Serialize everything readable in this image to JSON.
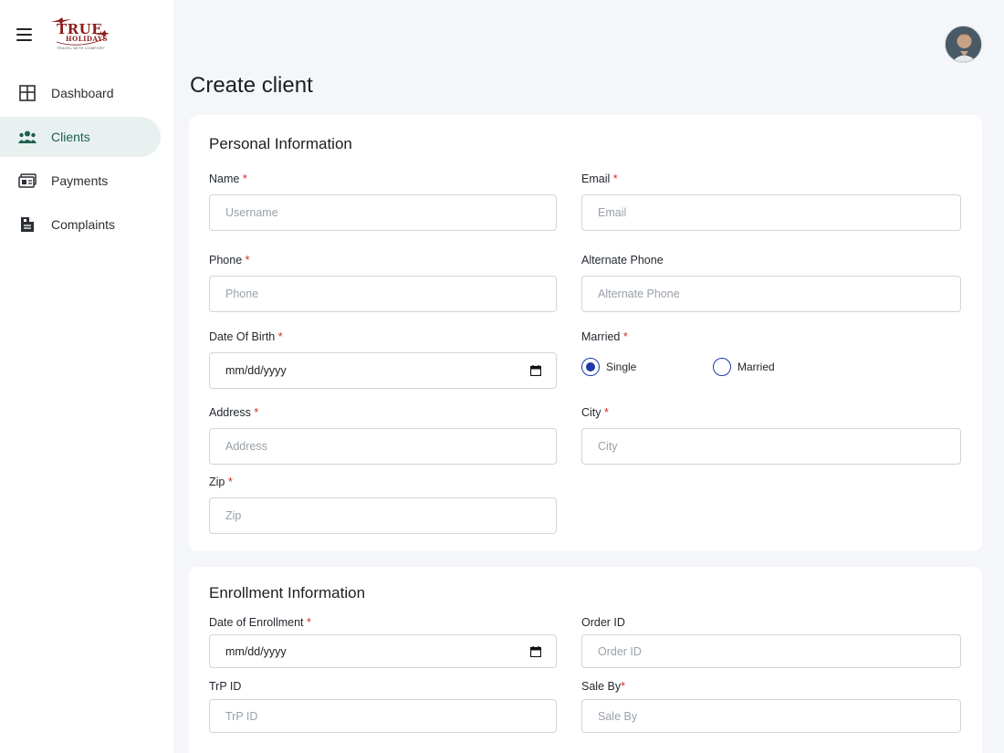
{
  "logo": {
    "word": "TRUE",
    "word2": "HOLIDAYS",
    "tagline": "TRAVEL WITH COMFORT"
  },
  "nav": {
    "items": [
      {
        "label": "Dashboard",
        "icon": "dashboard-icon",
        "active": false
      },
      {
        "label": "Clients",
        "icon": "users-icon",
        "active": true
      },
      {
        "label": "Payments",
        "icon": "payments-icon",
        "active": false
      },
      {
        "label": "Complaints",
        "icon": "complaints-icon",
        "active": false
      }
    ]
  },
  "page": {
    "title": "Create client"
  },
  "personal": {
    "heading": "Personal Information",
    "name": {
      "label": "Name",
      "placeholder": "Username",
      "required": "*"
    },
    "email": {
      "label": "Email",
      "placeholder": "Email",
      "required": "*"
    },
    "phone": {
      "label": "Phone",
      "placeholder": "Phone",
      "required": "*"
    },
    "alt_phone": {
      "label": "Alternate Phone",
      "placeholder": "Alternate Phone"
    },
    "dob": {
      "label": "Date Of Birth",
      "value": "mm/dd/yyyy",
      "required": "*"
    },
    "married": {
      "label": "Married",
      "required": "*",
      "options": [
        "Single",
        "Married"
      ],
      "selected": "Single"
    },
    "address": {
      "label": "Address",
      "placeholder": "Address",
      "required": "*"
    },
    "city": {
      "label": "City",
      "placeholder": "City",
      "required": "*"
    },
    "zip": {
      "label": "Zip",
      "placeholder": "Zip",
      "required": "*"
    }
  },
  "enrollment": {
    "heading": "Enrollment Information",
    "date": {
      "label": "Date of Enrollment",
      "value": "mm/dd/yyyy",
      "required": "*"
    },
    "order_id": {
      "label": "Order ID",
      "placeholder": "Order ID"
    },
    "trp_id": {
      "label": "TrP ID",
      "placeholder": "TrP ID"
    },
    "sale_by": {
      "label": "Sale By",
      "placeholder": "Sale By",
      "required": "*"
    }
  },
  "colors": {
    "accent": "#1e3aa8",
    "active_nav_bg": "#e8f1ef",
    "active_nav_text": "#1f5e52",
    "required": "#d62828",
    "brand": "#8b1d1d"
  }
}
